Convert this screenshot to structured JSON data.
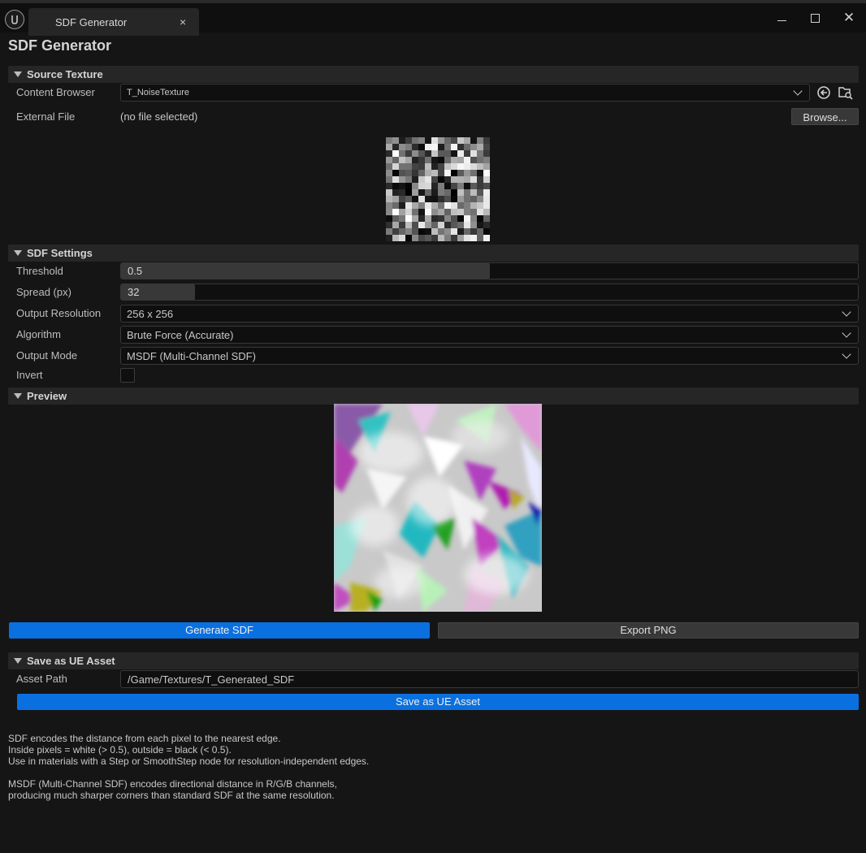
{
  "window": {
    "tab_title": "SDF Generator",
    "tab_close": "×",
    "close_glyph": "✕"
  },
  "panel": {
    "title": "SDF Generator"
  },
  "source_texture": {
    "header": "Source Texture",
    "content_browser_label": "Content Browser",
    "content_browser_value": "T_NoiseTexture",
    "external_file_label": "External File",
    "external_file_value": "(no file selected)",
    "browse_label": "Browse..."
  },
  "sdf_settings": {
    "header": "SDF Settings",
    "threshold_label": "Threshold",
    "threshold_value": "0.5",
    "threshold_fraction": 0.5,
    "spread_label": "Spread (px)",
    "spread_value": "32",
    "spread_fraction": 0.1,
    "output_resolution_label": "Output Resolution",
    "output_resolution_value": "256 x 256",
    "algorithm_label": "Algorithm",
    "algorithm_value": "Brute Force (Accurate)",
    "output_mode_label": "Output Mode",
    "output_mode_value": "MSDF (Multi-Channel SDF)",
    "invert_label": "Invert",
    "invert_checked": false
  },
  "preview": {
    "header": "Preview"
  },
  "actions": {
    "generate_label": "Generate SDF",
    "export_label": "Export PNG"
  },
  "save_asset": {
    "header": "Save as UE Asset",
    "asset_path_label": "Asset Path",
    "asset_path_value": "/Game/Textures/T_Generated_SDF",
    "save_label": "Save as UE Asset"
  },
  "help_text": {
    "line1": "SDF encodes the distance from each pixel to the nearest edge.",
    "line2": "Inside pixels = white (> 0.5), outside = black (< 0.5).",
    "line3": "Use in materials with a Step or SmoothStep node for resolution-independent edges.",
    "line4": "MSDF (Multi-Channel SDF) encodes directional distance in R/G/B channels,",
    "line5": "producing much sharper corners than standard SDF at the same resolution."
  },
  "colors": {
    "accent_blue": "#0a70e0",
    "background": "#151515",
    "section_header": "#262626"
  }
}
